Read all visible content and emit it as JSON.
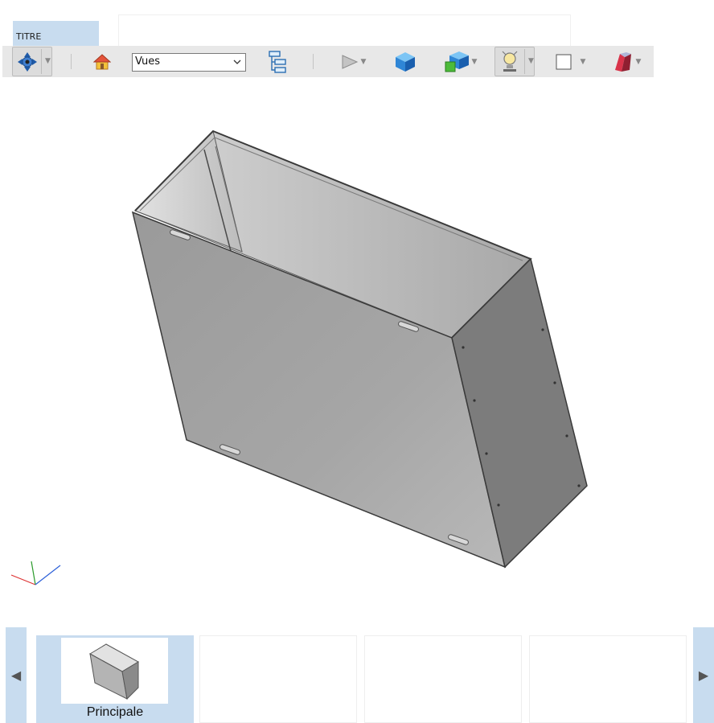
{
  "header": {
    "title_tab_label": "TITRE",
    "title_field_value": ""
  },
  "toolbar": {
    "views_select_value": "Vues",
    "items": [
      "navigate-icon",
      "home-icon",
      "views-dropdown",
      "model-tree-icon",
      "play-animation-icon",
      "display-style-icon",
      "explode-icon",
      "lighting-icon",
      "background-color-icon",
      "section-icon"
    ]
  },
  "viewport": {
    "model": "sheet-metal-box-isometric",
    "axis_triad": [
      "x-axis",
      "y-axis",
      "z-axis"
    ]
  },
  "views_strip": {
    "prev_label": "◀",
    "next_label": "▶",
    "views": [
      {
        "label": "Principale",
        "selected": true
      },
      {
        "label": "",
        "selected": false
      },
      {
        "label": "",
        "selected": false
      },
      {
        "label": "",
        "selected": false
      }
    ]
  },
  "colors": {
    "accent": "#c8dcef",
    "toolbar_bg": "#e8e8e8",
    "model_gray": "#a0a0a0"
  }
}
